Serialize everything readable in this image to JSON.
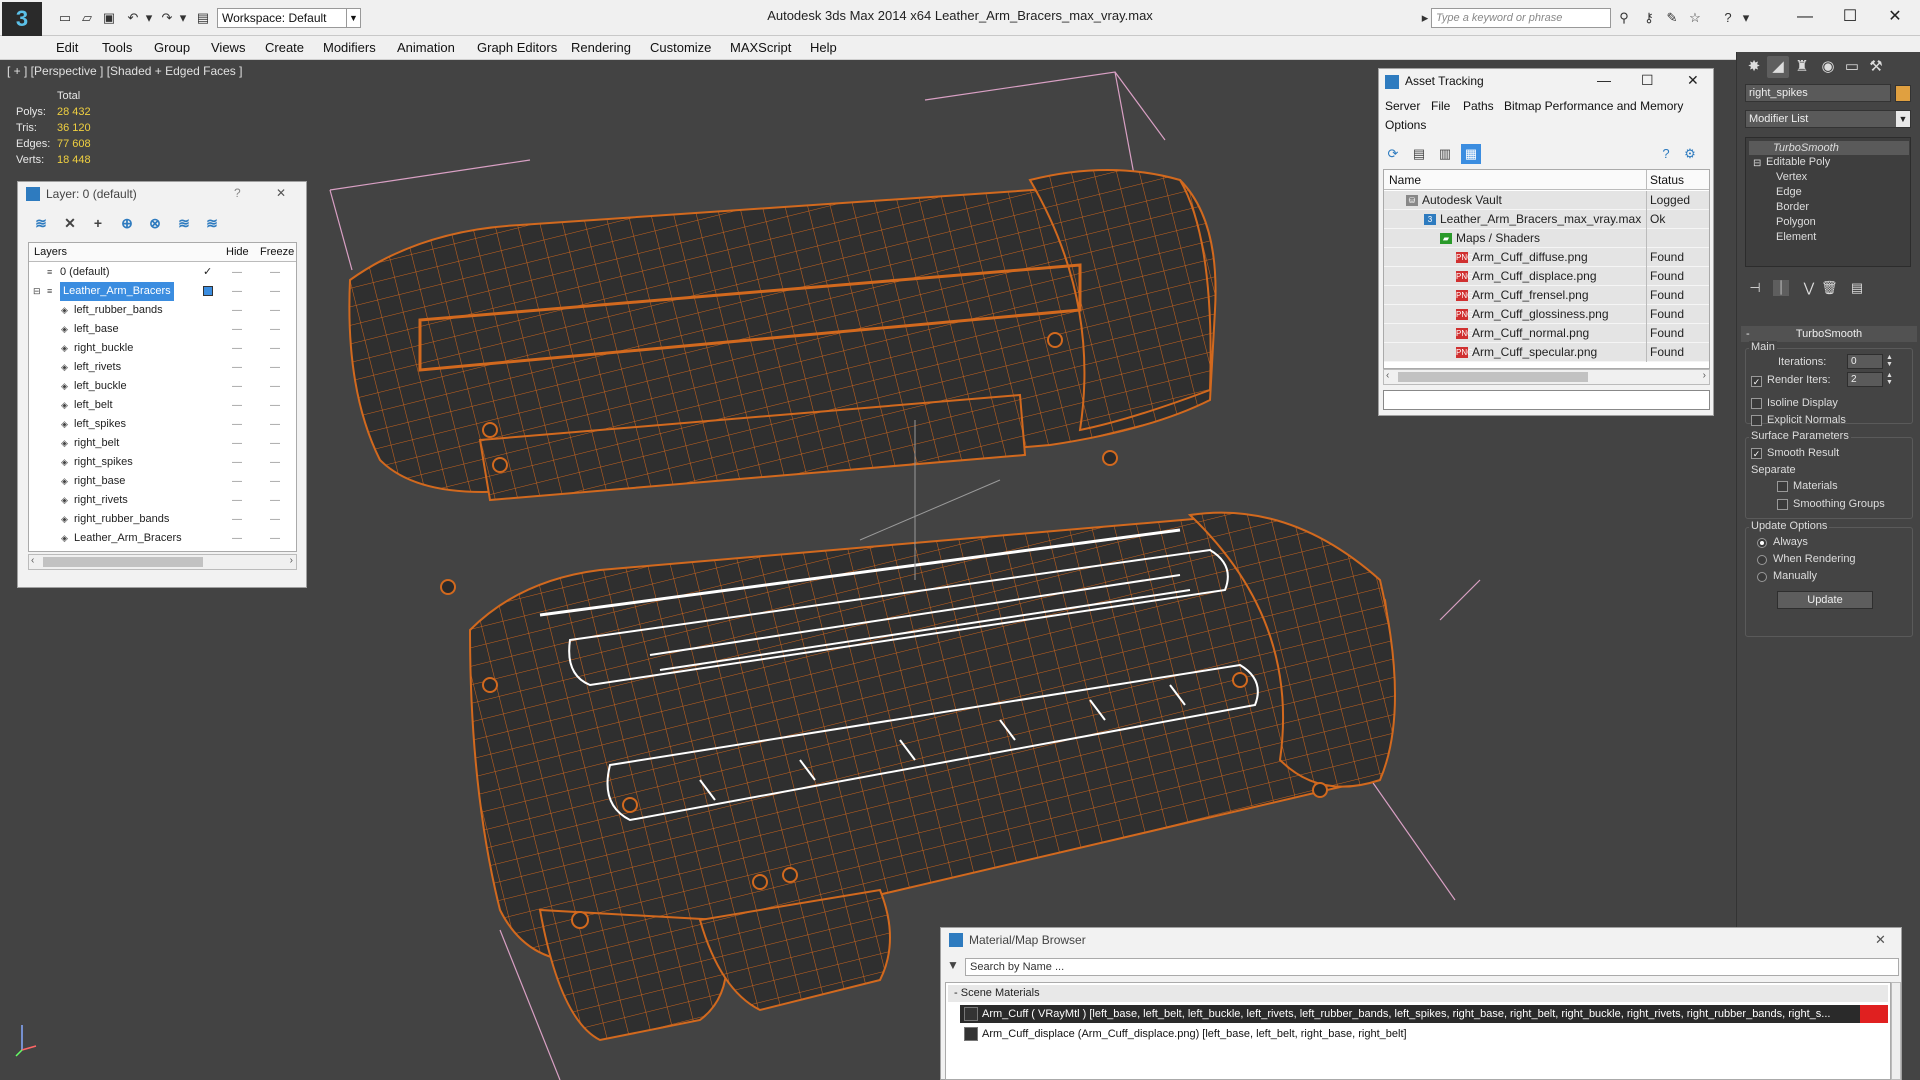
{
  "app": {
    "title": "Autodesk 3ds Max  2014 x64      Leather_Arm_Bracers_max_vray.max",
    "logo": "3ds-max-logo",
    "workspace": "Workspace: Default",
    "search_placeholder": "Type a keyword or phrase"
  },
  "menu": [
    "Edit",
    "Tools",
    "Group",
    "Views",
    "Create",
    "Modifiers",
    "Animation",
    "Graph Editors",
    "Rendering",
    "Customize",
    "MAXScript",
    "Help"
  ],
  "viewport": {
    "label": "[ + ] [Perspective ] [Shaded + Edged Faces ]",
    "stats": {
      "header": "Total",
      "rows": [
        {
          "k": "Polys:",
          "v": "28 432"
        },
        {
          "k": "Tris:",
          "v": "36 120"
        },
        {
          "k": "Edges:",
          "v": "77 608"
        },
        {
          "k": "Verts:",
          "v": "18 448"
        }
      ]
    },
    "colors": {
      "background": "#434343",
      "wire": "#d2691e",
      "mesh": "#2f2f2f",
      "selection": "#ffffff",
      "bbox": "#e0a0c8"
    }
  },
  "layer_panel": {
    "title": "Layer: 0 (default)",
    "help": "?",
    "close": "✕",
    "columns": {
      "layers": "Layers",
      "hide": "Hide",
      "freeze": "Freeze"
    },
    "rows": [
      {
        "name": "0 (default)",
        "check": "✓",
        "hide": "—",
        "freeze": "—"
      },
      {
        "name": "Leather_Arm_Bracers",
        "check": "",
        "hide": "—",
        "freeze": "—"
      },
      {
        "name": "left_rubber_bands",
        "hide": "—",
        "freeze": "—"
      },
      {
        "name": "left_base",
        "hide": "—",
        "freeze": "—"
      },
      {
        "name": "right_buckle",
        "hide": "—",
        "freeze": "—"
      },
      {
        "name": "left_rivets",
        "hide": "—",
        "freeze": "—"
      },
      {
        "name": "left_buckle",
        "hide": "—",
        "freeze": "—"
      },
      {
        "name": "left_belt",
        "hide": "—",
        "freeze": "—"
      },
      {
        "name": "left_spikes",
        "hide": "—",
        "freeze": "—"
      },
      {
        "name": "right_belt",
        "hide": "—",
        "freeze": "—"
      },
      {
        "name": "right_spikes",
        "hide": "—",
        "freeze": "—"
      },
      {
        "name": "right_base",
        "hide": "—",
        "freeze": "—"
      },
      {
        "name": "right_rivets",
        "hide": "—",
        "freeze": "—"
      },
      {
        "name": "right_rubber_bands",
        "hide": "—",
        "freeze": "—"
      },
      {
        "name": "Leather_Arm_Bracers",
        "hide": "—",
        "freeze": "—"
      }
    ]
  },
  "asset_panel": {
    "title": "Asset Tracking",
    "menu": [
      "Server",
      "File",
      "Paths",
      "Bitmap Performance and Memory",
      "Options"
    ],
    "columns": {
      "name": "Name",
      "status": "Status"
    },
    "rows": [
      {
        "name": "Autodesk Vault",
        "status": "Logged Out"
      },
      {
        "name": "Leather_Arm_Bracers_max_vray.max",
        "status": "Ok"
      },
      {
        "name": "Maps / Shaders",
        "status": ""
      },
      {
        "name": "Arm_Cuff_diffuse.png",
        "status": "Found"
      },
      {
        "name": "Arm_Cuff_displace.png",
        "status": "Found"
      },
      {
        "name": "Arm_Cuff_frensel.png",
        "status": "Found"
      },
      {
        "name": "Arm_Cuff_glossiness.png",
        "status": "Found"
      },
      {
        "name": "Arm_Cuff_normal.png",
        "status": "Found"
      },
      {
        "name": "Arm_Cuff_specular.png",
        "status": "Found"
      }
    ]
  },
  "command_panel": {
    "object_name": "right_spikes",
    "object_color": "#e0a040",
    "modifier_list": "Modifier List",
    "stack": [
      "TurboSmooth",
      "Editable Poly",
      "Vertex",
      "Edge",
      "Border",
      "Polygon",
      "Element"
    ],
    "turbosmooth": {
      "title": "TurboSmooth",
      "main": "Main",
      "iterations_label": "Iterations:",
      "iterations": "0",
      "render_iters_label": "Render Iters:",
      "render_iters": "2",
      "isoline": "Isoline Display",
      "explicit_normals": "Explicit Normals",
      "surface_params": "Surface Parameters",
      "smooth_result": "Smooth Result",
      "separate": "Separate",
      "materials": "Materials",
      "smoothing_groups": "Smoothing Groups",
      "update_options": "Update Options",
      "always": "Always",
      "when_rendering": "When Rendering",
      "manually": "Manually",
      "update_btn": "Update"
    }
  },
  "material_browser": {
    "title": "Material/Map Browser",
    "close": "✕",
    "search": "Search by Name ...",
    "section": "Scene Materials",
    "rows": [
      "Arm_Cuff ( VRayMtl ) [left_base, left_belt, left_buckle, left_rivets, left_rubber_bands, left_spikes, right_base, right_belt, right_buckle, right_rivets, right_rubber_bands, right_s...",
      "Arm_Cuff_displace (Arm_Cuff_displace.png) [left_base, left_belt, right_base, right_belt]"
    ]
  }
}
